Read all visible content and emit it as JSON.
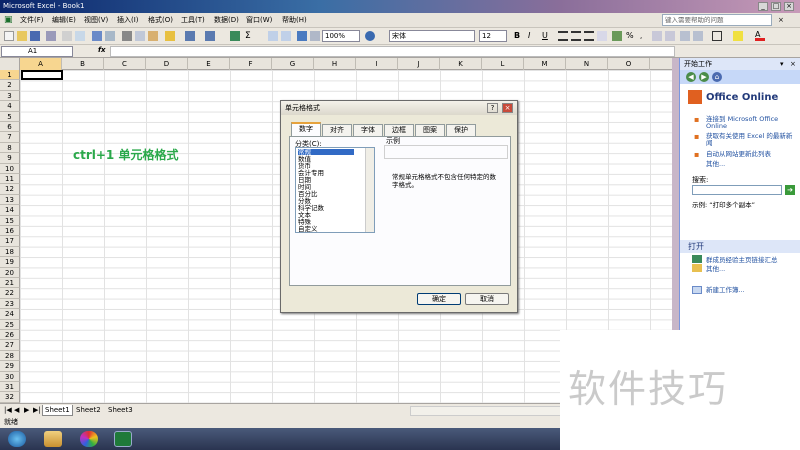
{
  "window": {
    "title": "Microsoft Excel - Book1"
  },
  "menu": {
    "items": [
      "文件(F)",
      "编辑(E)",
      "视图(V)",
      "插入(I)",
      "格式(O)",
      "工具(T)",
      "数据(D)",
      "窗口(W)",
      "帮助(H)"
    ],
    "help_placeholder": "键入需要帮助的问题"
  },
  "toolbar": {
    "zoom": "100%",
    "font": "宋体",
    "size": "12",
    "bold": "B",
    "italic": "I",
    "underline": "U"
  },
  "formula": {
    "name_box": "A1",
    "fx": "fx",
    "value": ""
  },
  "grid": {
    "columns": [
      "A",
      "B",
      "C",
      "D",
      "E",
      "F",
      "G",
      "H",
      "I",
      "J",
      "K",
      "L",
      "M",
      "N",
      "O"
    ],
    "rows": [
      "1",
      "2",
      "3",
      "4",
      "5",
      "6",
      "7",
      "8",
      "9",
      "10",
      "11",
      "12",
      "13",
      "14",
      "15",
      "16",
      "17",
      "18",
      "19",
      "20",
      "21",
      "22",
      "23",
      "24",
      "25",
      "26",
      "27",
      "28",
      "29",
      "30",
      "31",
      "32"
    ],
    "annotation": "ctrl+1  单元格格式"
  },
  "dialog": {
    "title": "单元格格式",
    "tabs": [
      "数字",
      "对齐",
      "字体",
      "边框",
      "图案",
      "保护"
    ],
    "category_label": "分类(C):",
    "categories": [
      "常规",
      "数值",
      "货币",
      "会计专用",
      "日期",
      "时间",
      "百分比",
      "分数",
      "科学记数",
      "文本",
      "特殊",
      "自定义"
    ],
    "sample_label": "示例",
    "description": "常规单元格格式不包含任何特定的数字格式。",
    "ok": "确定",
    "cancel": "取消"
  },
  "taskpane": {
    "header": "开始工作",
    "logo": "Office Online",
    "links": [
      "连接到 Microsoft Office Online",
      "获取有关使用 Excel 的最新新闻",
      "自动从网站更新此列表"
    ],
    "more": "其他...",
    "search_label": "搜索:",
    "example": "示例: “打印多个副本”",
    "open_section": "打开",
    "open_items": [
      "群成员经验主页链接汇总",
      "其他..."
    ],
    "new_workbook": "新建工作簿..."
  },
  "sheets": {
    "tabs": [
      "Sheet1",
      "Sheet2",
      "Sheet3"
    ]
  },
  "status": {
    "text": "就绪"
  },
  "watermark": {
    "text": "软件技巧"
  }
}
